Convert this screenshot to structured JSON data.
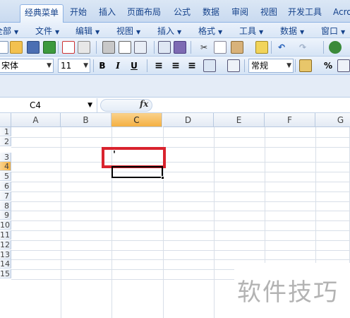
{
  "ribbon_tabs": [
    "经典菜单",
    "开始",
    "插入",
    "页面布局",
    "公式",
    "数据",
    "审阅",
    "视图",
    "开发工具",
    "Acro"
  ],
  "menus": [
    "全部",
    "文件",
    "编辑",
    "视图",
    "插入",
    "格式",
    "工具",
    "数据",
    "窗口"
  ],
  "toolbar_icons": [
    "new-doc",
    "open",
    "save",
    "excel",
    "print-preview",
    "pdf",
    "print",
    "preview",
    "page-setup",
    "spell-check",
    "book",
    "cut",
    "copy",
    "paste",
    "format-painter",
    "undo",
    "redo",
    "spacer",
    "network"
  ],
  "font": {
    "name": "宋体",
    "size": "11"
  },
  "format_buttons": [
    "B",
    "I",
    "U"
  ],
  "number_format": "常规",
  "percent_label": "%",
  "name_box": "C4",
  "fx_label": "fx",
  "columns": [
    "A",
    "B",
    "C",
    "D",
    "E",
    "F",
    "G"
  ],
  "selected_column": "C",
  "rows": [
    "1",
    "2",
    "3",
    "4",
    "5",
    "6",
    "7",
    "8",
    "9",
    "10",
    "11",
    "12",
    "13",
    "14",
    "15"
  ],
  "selected_row": "4",
  "cell_c3_value": "'",
  "watermark": "软件技巧",
  "colors": {
    "accent": "#f4b042",
    "highlight": "#d9232e",
    "ribbon": "#c9daf0"
  }
}
